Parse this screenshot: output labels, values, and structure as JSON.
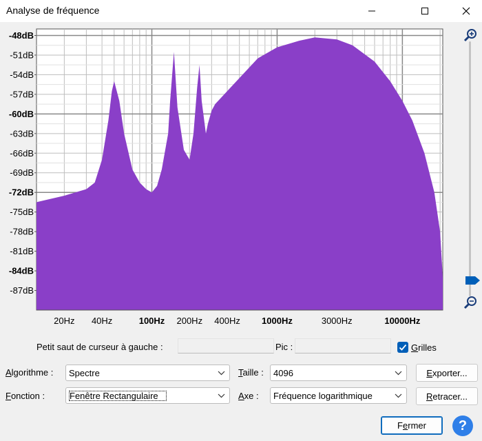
{
  "window": {
    "title": "Analyse de fréquence"
  },
  "chart_data": {
    "type": "area",
    "color": "#8a3fc8",
    "xscale": "log",
    "xlim": [
      12,
      21000
    ],
    "ylim": [
      -90,
      -47
    ],
    "x_ticks": [
      "20Hz",
      "40Hz",
      "100Hz",
      "200Hz",
      "400Hz",
      "1000Hz",
      "3000Hz",
      "10000Hz"
    ],
    "y_ticks": [
      "-48dB",
      "-51dB",
      "-54dB",
      "-57dB",
      "-60dB",
      "-63dB",
      "-66dB",
      "-69dB",
      "-72dB",
      "-75dB",
      "-78dB",
      "-81dB",
      "-84dB",
      "-87dB"
    ],
    "x": [
      12,
      20,
      30,
      35,
      40,
      45,
      48,
      50,
      55,
      60,
      70,
      80,
      90,
      100,
      110,
      120,
      135,
      140,
      150,
      160,
      180,
      200,
      215,
      230,
      240,
      250,
      270,
      280,
      300,
      320,
      400,
      500,
      700,
      1000,
      1500,
      2000,
      3000,
      4000,
      6000,
      8000,
      10000,
      12000,
      15000,
      18000,
      20000,
      21000
    ],
    "y": [
      -73.5,
      -72.5,
      -71.5,
      -70.5,
      -67,
      -61,
      -56.5,
      -55,
      -58,
      -63,
      -68.5,
      -70.5,
      -71.5,
      -72,
      -71,
      -68.5,
      -63,
      -58,
      -50.5,
      -59,
      -65.5,
      -67,
      -63,
      -56,
      -52.5,
      -58,
      -63,
      -61.5,
      -59.5,
      -58.5,
      -56.5,
      -54.5,
      -51.5,
      -49.8,
      -48.8,
      -48.3,
      -48.6,
      -49.5,
      -52,
      -55,
      -58,
      -61,
      -66,
      -72,
      -78,
      -85
    ]
  },
  "zoom": {
    "in_icon": "zoom-in-icon",
    "out_icon": "zoom-out-icon",
    "slider_accent": "#005fb8"
  },
  "controls": {
    "cursor_label": "Petit saut de curseur à gauche :",
    "cursor_value": "",
    "peak_label": "Pic :",
    "peak_value": "",
    "grid_label": "Grilles",
    "grid_checked": true,
    "algo_label": "Algorithme :",
    "algo_value": "Spectre",
    "size_label": "Taille :",
    "size_value": "4096",
    "export_label": "Exporter...",
    "func_label": "Fonction :",
    "func_value": "Fenêtre Rectangulaire",
    "axis_label": "Axe :",
    "axis_value": "Fréquence logarithmique",
    "replot_label": "Retracer...",
    "close_label": "Fermer",
    "help_label": "?"
  }
}
